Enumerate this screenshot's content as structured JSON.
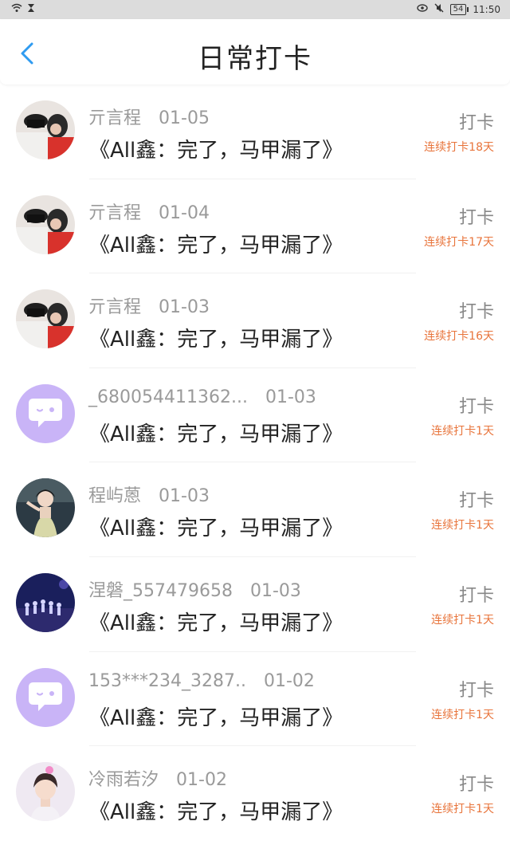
{
  "status_bar": {
    "time": "11:50",
    "battery": "54",
    "icons": [
      "wifi-icon",
      "hourglass-icon",
      "eye-icon",
      "mute-icon",
      "battery-icon"
    ]
  },
  "header": {
    "title": "日常打卡",
    "back_icon": "chevron-left-icon"
  },
  "colors": {
    "accent": "#2f9bf0",
    "streak": "#e8743b",
    "avatar_placeholder": "#c9b4f7"
  },
  "items": [
    {
      "name": "亓言程",
      "date": "01-05",
      "book": "《All鑫：完了，马甲漏了》",
      "button": "打卡",
      "streak": "连续打卡18天",
      "avatar": "couple-photo"
    },
    {
      "name": "亓言程",
      "date": "01-04",
      "book": "《All鑫：完了，马甲漏了》",
      "button": "打卡",
      "streak": "连续打卡17天",
      "avatar": "couple-photo"
    },
    {
      "name": "亓言程",
      "date": "01-03",
      "book": "《All鑫：完了，马甲漏了》",
      "button": "打卡",
      "streak": "连续打卡16天",
      "avatar": "couple-photo"
    },
    {
      "name": "_680054411362...",
      "date": "01-03",
      "book": "《All鑫：完了，马甲漏了》",
      "button": "打卡",
      "streak": "连续打卡1天",
      "avatar": "default-chat-bubble"
    },
    {
      "name": "程屿蒽",
      "date": "01-03",
      "book": "《All鑫：完了，马甲漏了》",
      "button": "打卡",
      "streak": "连续打卡1天",
      "avatar": "girl-photo"
    },
    {
      "name": "涅磐_557479658",
      "date": "01-03",
      "book": "《All鑫：完了，马甲漏了》",
      "button": "打卡",
      "streak": "连续打卡1天",
      "avatar": "stage-photo"
    },
    {
      "name": "153***234_3287..",
      "date": "01-02",
      "book": "《All鑫：完了，马甲漏了》",
      "button": "打卡",
      "streak": "连续打卡1天",
      "avatar": "default-chat-bubble"
    },
    {
      "name": "冷雨若汐",
      "date": "01-02",
      "book": "《All鑫：完了，马甲漏了》",
      "button": "打卡",
      "streak": "连续打卡1天",
      "avatar": "boy-photo"
    }
  ]
}
